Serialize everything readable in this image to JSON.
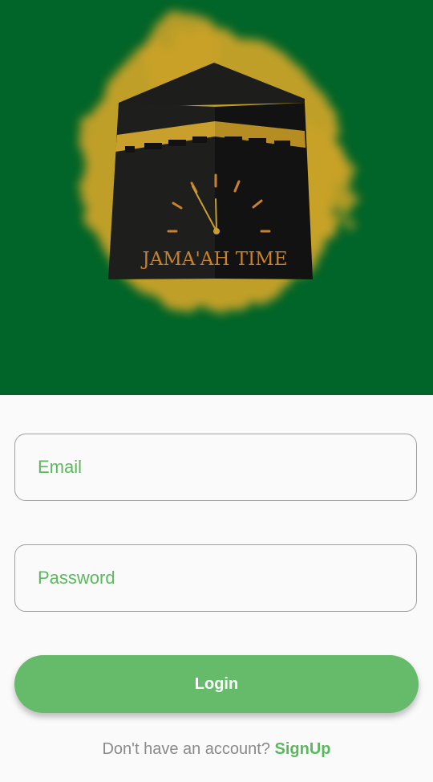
{
  "header": {
    "logo_text": "JAMA'AH TIME",
    "background_color": "#016428",
    "accent_color": "#d6a22a"
  },
  "login_form": {
    "email": {
      "placeholder": "Email",
      "value": ""
    },
    "password": {
      "placeholder": "Password",
      "value": ""
    },
    "login_label": "Login",
    "signup_prompt": "Don't have an account?",
    "signup_label": "SignUp",
    "primary_color": "#66bb6a"
  }
}
